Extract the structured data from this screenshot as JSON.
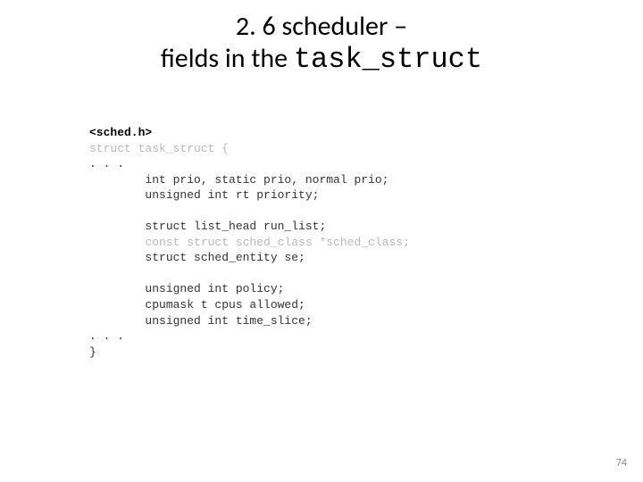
{
  "title": {
    "line1": "2. 6 scheduler –",
    "line2_prefix": "fields in the ",
    "line2_code": "task_struct"
  },
  "code": {
    "header": "<sched.h>",
    "decl": "struct task_struct {",
    "ellipsis1": ". . .",
    "l1": "        int prio, static prio, normal prio;",
    "l2": "        unsigned int rt priority;",
    "blank1": "",
    "l3": "        struct list_head run_list;",
    "l4": "        const struct sched_class *sched_class;",
    "l5": "        struct sched_entity se;",
    "blank2": "",
    "l6": "        unsigned int policy;",
    "l7": "        cpumask t cpus allowed;",
    "l8": "        unsigned int time_slice;",
    "ellipsis2": ". . .",
    "close": "}"
  },
  "page_number": "74"
}
